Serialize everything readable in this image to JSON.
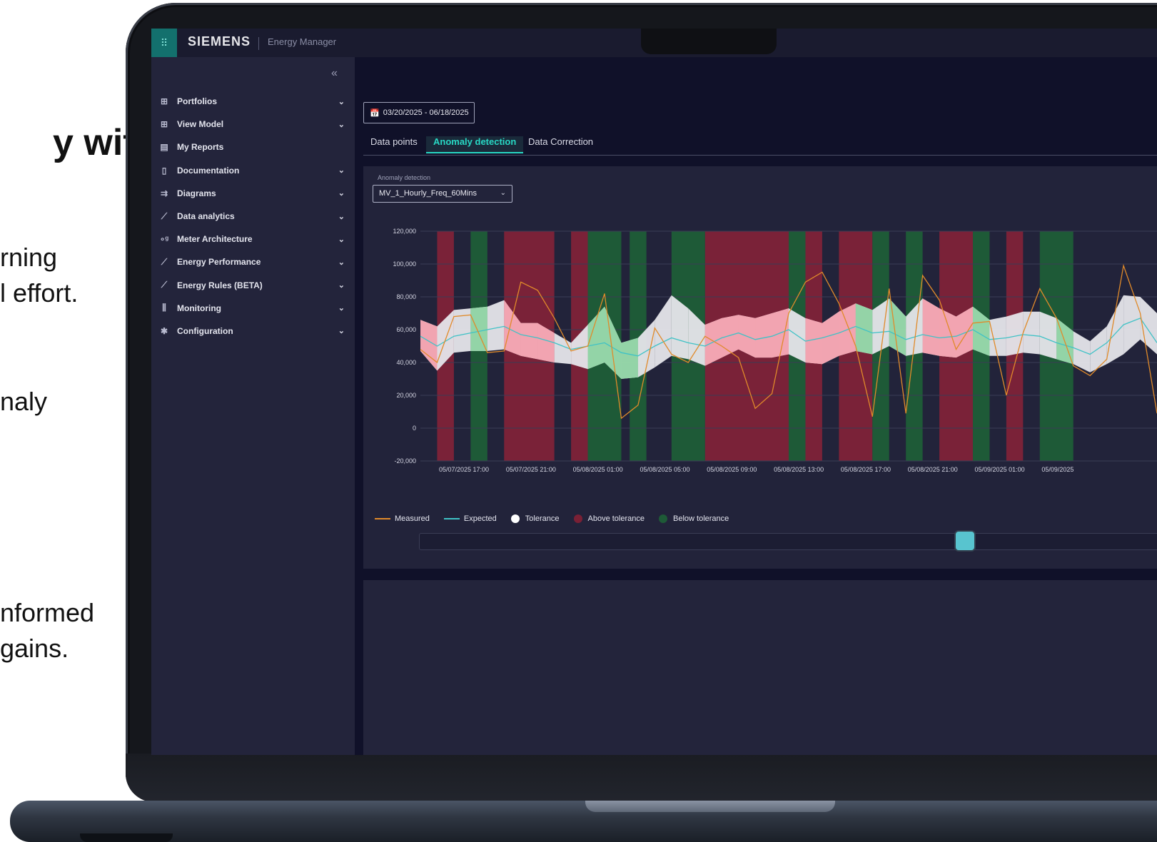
{
  "slide": {
    "title_fragment": "y with",
    "lines": [
      "rning",
      "l effort.",
      "naly",
      "nformed",
      "gains."
    ]
  },
  "app": {
    "brand": "SIEMENS",
    "name": "Energy Manager",
    "collapse_icon": "«"
  },
  "sidebar": {
    "items": [
      {
        "label": "Portfolios",
        "icon": "portfolio-icon",
        "glyph": "⊞",
        "expandable": true
      },
      {
        "label": "View Model",
        "icon": "view-model-icon",
        "glyph": "⊞",
        "expandable": true
      },
      {
        "label": "My Reports",
        "icon": "report-icon",
        "glyph": "▤",
        "expandable": false
      },
      {
        "label": "Documentation",
        "icon": "document-icon",
        "glyph": "▯",
        "expandable": true
      },
      {
        "label": "Diagrams",
        "icon": "diagram-icon",
        "glyph": "⇉",
        "expandable": true
      },
      {
        "label": "Data analytics",
        "icon": "analytics-icon",
        "glyph": "⟋",
        "expandable": true
      },
      {
        "label": "Meter Architecture",
        "icon": "meter-icon",
        "glyph": "∘ᵍ",
        "expandable": true
      },
      {
        "label": "Energy Performance",
        "icon": "performance-icon",
        "glyph": "⟋",
        "expandable": true
      },
      {
        "label": "Energy Rules (BETA)",
        "icon": "rules-icon",
        "glyph": "⟋",
        "expandable": true
      },
      {
        "label": "Monitoring",
        "icon": "monitoring-icon",
        "glyph": "⫼",
        "expandable": true
      },
      {
        "label": "Configuration",
        "icon": "gear-icon",
        "glyph": "✱",
        "expandable": true
      }
    ]
  },
  "date_range": {
    "label": "03/20/2025 - 06/18/2025",
    "icon": "calendar-icon"
  },
  "tabs": [
    {
      "label": "Data points",
      "active": false
    },
    {
      "label": "Anomaly detection",
      "active": true
    },
    {
      "label": "Data Correction",
      "active": false
    }
  ],
  "anomaly": {
    "field_label": "Anomaly detection",
    "selected": "MV_1_Hourly_Freq_60Mins"
  },
  "legend": [
    {
      "label": "Measured",
      "kind": "line",
      "color": "#e08a2a"
    },
    {
      "label": "Expected",
      "kind": "line",
      "color": "#3fc2c6"
    },
    {
      "label": "Tolerance",
      "kind": "dot",
      "color": "#ffffff"
    },
    {
      "label": "Above tolerance",
      "kind": "dot",
      "color": "#7a2035"
    },
    {
      "label": "Below tolerance",
      "kind": "dot",
      "color": "#1e5a37"
    }
  ],
  "colors": {
    "accent": "#28d8c4",
    "above_band": "#7a2238",
    "below_band": "#1e5a37",
    "tolerance_in": "#e6e6ea",
    "tolerance_above": "#f2a1ae",
    "tolerance_below": "#8fd3a3"
  },
  "chart_data": {
    "type": "line",
    "y_ticks": [
      "120,000",
      "100,000",
      "80,000",
      "60,000",
      "40,000",
      "20,000",
      "0",
      "-20,000"
    ],
    "ylim": [
      -20000,
      120000
    ],
    "x_ticks": [
      "05/07/2025 17:00",
      "05/07/2025 21:00",
      "05/08/2025 01:00",
      "05/08/2025 05:00",
      "05/08/2025 09:00",
      "05/08/2025 13:00",
      "05/08/2025 17:00",
      "05/08/2025 21:00",
      "05/09/2025 01:00",
      "05/09/2025"
    ],
    "x_start_hour": 0,
    "series": [
      {
        "name": "Measured",
        "values": [
          48000,
          40000,
          68000,
          69000,
          46000,
          47000,
          89000,
          84000,
          67000,
          47000,
          50000,
          82000,
          6000,
          14000,
          61000,
          45000,
          40000,
          56000,
          50000,
          43000,
          12000,
          21000,
          70000,
          89000,
          95000,
          76000,
          50000,
          7000,
          85000,
          9000,
          93000,
          78000,
          48000,
          64000,
          65000,
          20000,
          58000,
          85000,
          67000,
          38000,
          32000,
          42000,
          99000,
          70000,
          9000
        ]
      },
      {
        "name": "Expected",
        "values": [
          56000,
          50000,
          56000,
          58000,
          60000,
          62000,
          57000,
          55000,
          52000,
          48000,
          50000,
          52000,
          46000,
          44000,
          50000,
          55000,
          52000,
          50000,
          55000,
          58000,
          54000,
          56000,
          60000,
          53000,
          55000,
          58000,
          62000,
          58000,
          59000,
          54000,
          57000,
          55000,
          56000,
          60000,
          54000,
          55000,
          57000,
          56000,
          52000,
          49000,
          45000,
          52000,
          63000,
          67000,
          52000
        ]
      },
      {
        "name": "Tolerance upper",
        "values": [
          66000,
          62000,
          72000,
          73000,
          74000,
          78000,
          64000,
          64000,
          58000,
          52000,
          63000,
          74000,
          52000,
          55000,
          66000,
          81000,
          73000,
          63000,
          67000,
          69000,
          67000,
          70000,
          73000,
          67000,
          64000,
          71000,
          76000,
          72000,
          79000,
          68000,
          79000,
          73000,
          68000,
          74000,
          66000,
          68000,
          71000,
          71000,
          67000,
          59000,
          53000,
          62000,
          81000,
          80000,
          70000
        ]
      },
      {
        "name": "Tolerance lower",
        "values": [
          47000,
          35000,
          46000,
          47000,
          47000,
          48000,
          44000,
          42000,
          40000,
          39000,
          36000,
          40000,
          30000,
          31000,
          37000,
          44000,
          42000,
          38000,
          43000,
          48000,
          43000,
          43000,
          45000,
          40000,
          39000,
          44000,
          47000,
          45000,
          50000,
          44000,
          46000,
          44000,
          43000,
          48000,
          44000,
          44000,
          46000,
          45000,
          42000,
          39000,
          34000,
          39000,
          45000,
          54000,
          45000
        ]
      }
    ],
    "above_tolerance_hours": [
      [
        1,
        2
      ],
      [
        5,
        8
      ],
      [
        9,
        10
      ],
      [
        17,
        22
      ],
      [
        23,
        24
      ],
      [
        25,
        27
      ],
      [
        31,
        33
      ],
      [
        35,
        36
      ]
    ],
    "below_tolerance_hours": [
      [
        3,
        4
      ],
      [
        10,
        12
      ],
      [
        12.5,
        13.5
      ],
      [
        15,
        17
      ],
      [
        22,
        23
      ],
      [
        27,
        28
      ],
      [
        29,
        30
      ],
      [
        33,
        34
      ],
      [
        37,
        39
      ]
    ],
    "tolerance_above_hours": [
      [
        0,
        1
      ],
      [
        5,
        8
      ],
      [
        17,
        22
      ],
      [
        23,
        26
      ],
      [
        30,
        33
      ]
    ],
    "tolerance_below_hours": [
      [
        3,
        4
      ],
      [
        10,
        12
      ],
      [
        12.5,
        13
      ],
      [
        26,
        27
      ],
      [
        28,
        29
      ],
      [
        33,
        34
      ],
      [
        38,
        39
      ]
    ],
    "xlabel": "",
    "ylabel": "",
    "grid": true
  }
}
